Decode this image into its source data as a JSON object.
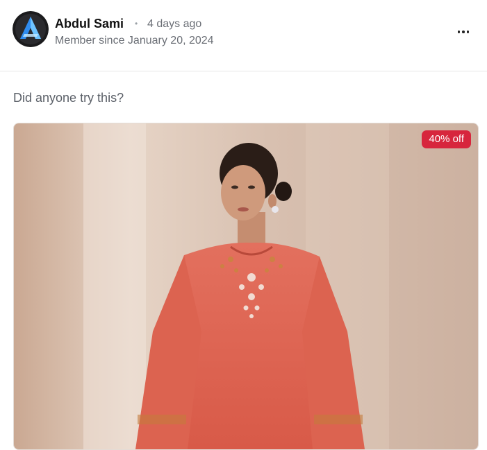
{
  "post": {
    "author": {
      "name": "Abdul Sami",
      "time_ago": "4 days ago",
      "separator": "•",
      "member_since": "Member since January 20, 2024",
      "avatar_icon": "brand-logo-a-icon"
    },
    "more_icon": "more-horizontal-icon",
    "text": "Did anyone try this?",
    "image": {
      "discount_badge": "40% off",
      "badge_color": "#d7263d"
    }
  }
}
